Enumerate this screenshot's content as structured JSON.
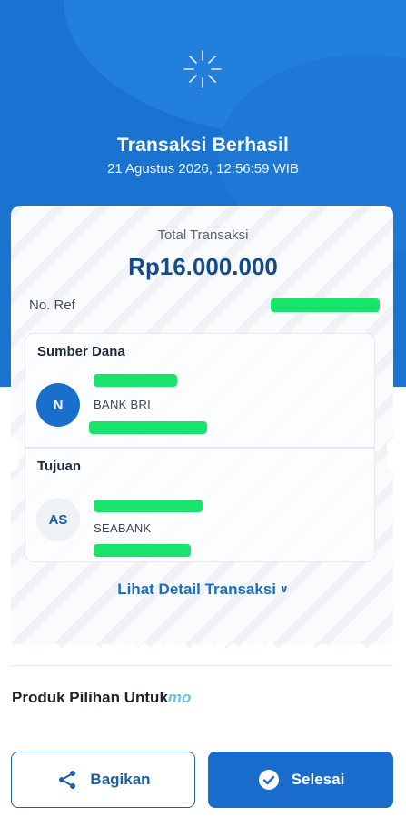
{
  "header": {
    "title": "Transaksi Berhasil",
    "datetime": "21 Agustus 2026, 12:56:59 WIB",
    "icon": "sparkle-icon"
  },
  "summary": {
    "total_label": "Total Transaksi",
    "total_value": "Rp16.000.000",
    "ref_label": "No. Ref"
  },
  "source": {
    "title": "Sumber Dana",
    "avatar_initial": "N",
    "bank": "BANK BRI"
  },
  "destination": {
    "title": "Tujuan",
    "avatar_initial": "AS",
    "bank": "SEABANK"
  },
  "detail_link": "Lihat Detail Transaksi",
  "products": {
    "title": "Produk Pilihan Untuk",
    "brand": "mo"
  },
  "actions": {
    "share_label": "Bagikan",
    "done_label": "Selesai"
  },
  "colors": {
    "primary": "#1a73d1",
    "dark_blue": "#134b8a",
    "redaction": "#18e46b"
  }
}
